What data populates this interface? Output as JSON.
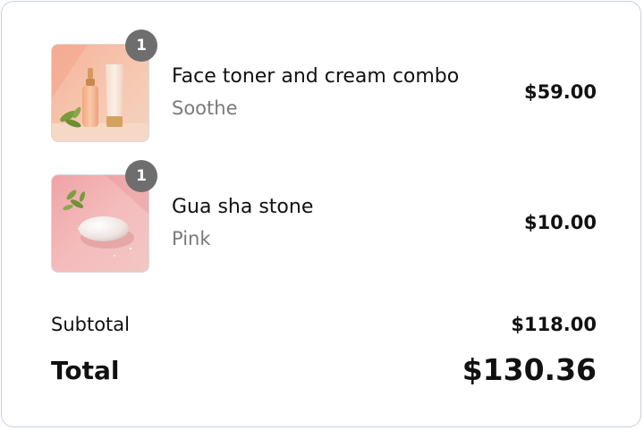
{
  "cart": {
    "items": [
      {
        "quantity": "1",
        "name": "Face toner and cream combo",
        "variant": "Soothe",
        "price": "$59.00",
        "image_icon": "skincare-bottles-image"
      },
      {
        "quantity": "1",
        "name": "Gua sha stone",
        "variant": "Pink",
        "price": "$10.00",
        "image_icon": "gua-sha-stone-image"
      }
    ]
  },
  "summary": {
    "subtotal_label": "Subtotal",
    "subtotal_value": "$118.00",
    "total_label": "Total",
    "total_value": "$130.36"
  },
  "colors": {
    "border": "#c9cfe2",
    "badge": "#6e6e6e",
    "variant_text": "#7a7a7a"
  }
}
